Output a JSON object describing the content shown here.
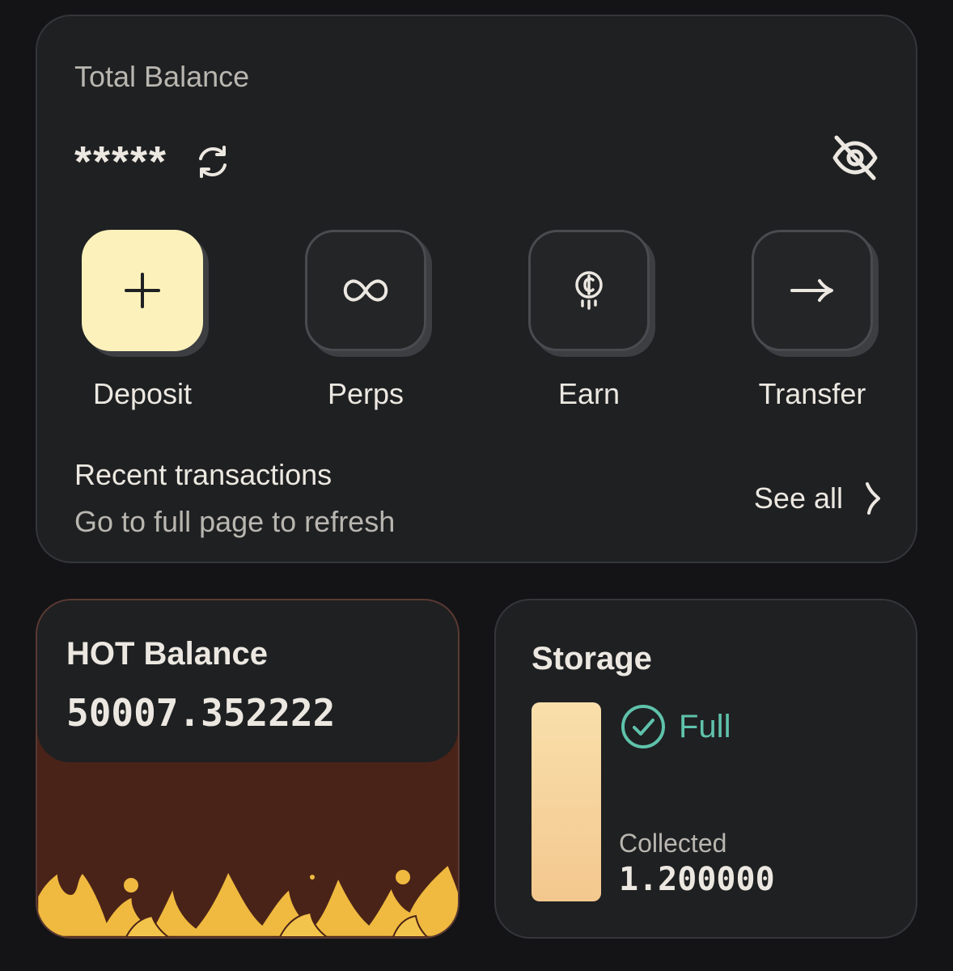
{
  "wallet": {
    "total_label": "Total Balance",
    "balance_masked": "*****",
    "refresh_icon": "refresh-icon",
    "hide_icon": "eye-off-icon",
    "actions": [
      {
        "label": "Deposit",
        "icon": "plus-icon"
      },
      {
        "label": "Perps",
        "icon": "infinity-icon"
      },
      {
        "label": "Earn",
        "icon": "coin-icon"
      },
      {
        "label": "Transfer",
        "icon": "arrow-right-icon"
      }
    ],
    "recent_title": "Recent transactions",
    "recent_subtitle": "Go to full page to refresh",
    "see_all": "See all"
  },
  "hot": {
    "title": "HOT Balance",
    "value": "50007.352222"
  },
  "storage": {
    "title": "Storage",
    "status": "Full",
    "collected_label": "Collected",
    "collected_value": "1.200000",
    "fill_fraction": 1.0
  },
  "colors": {
    "background": "#141416",
    "card": "#1f2022",
    "primary_button": "#fcf1bb",
    "status_green": "#5fc2ab",
    "fire_orange": "#efba3f"
  }
}
